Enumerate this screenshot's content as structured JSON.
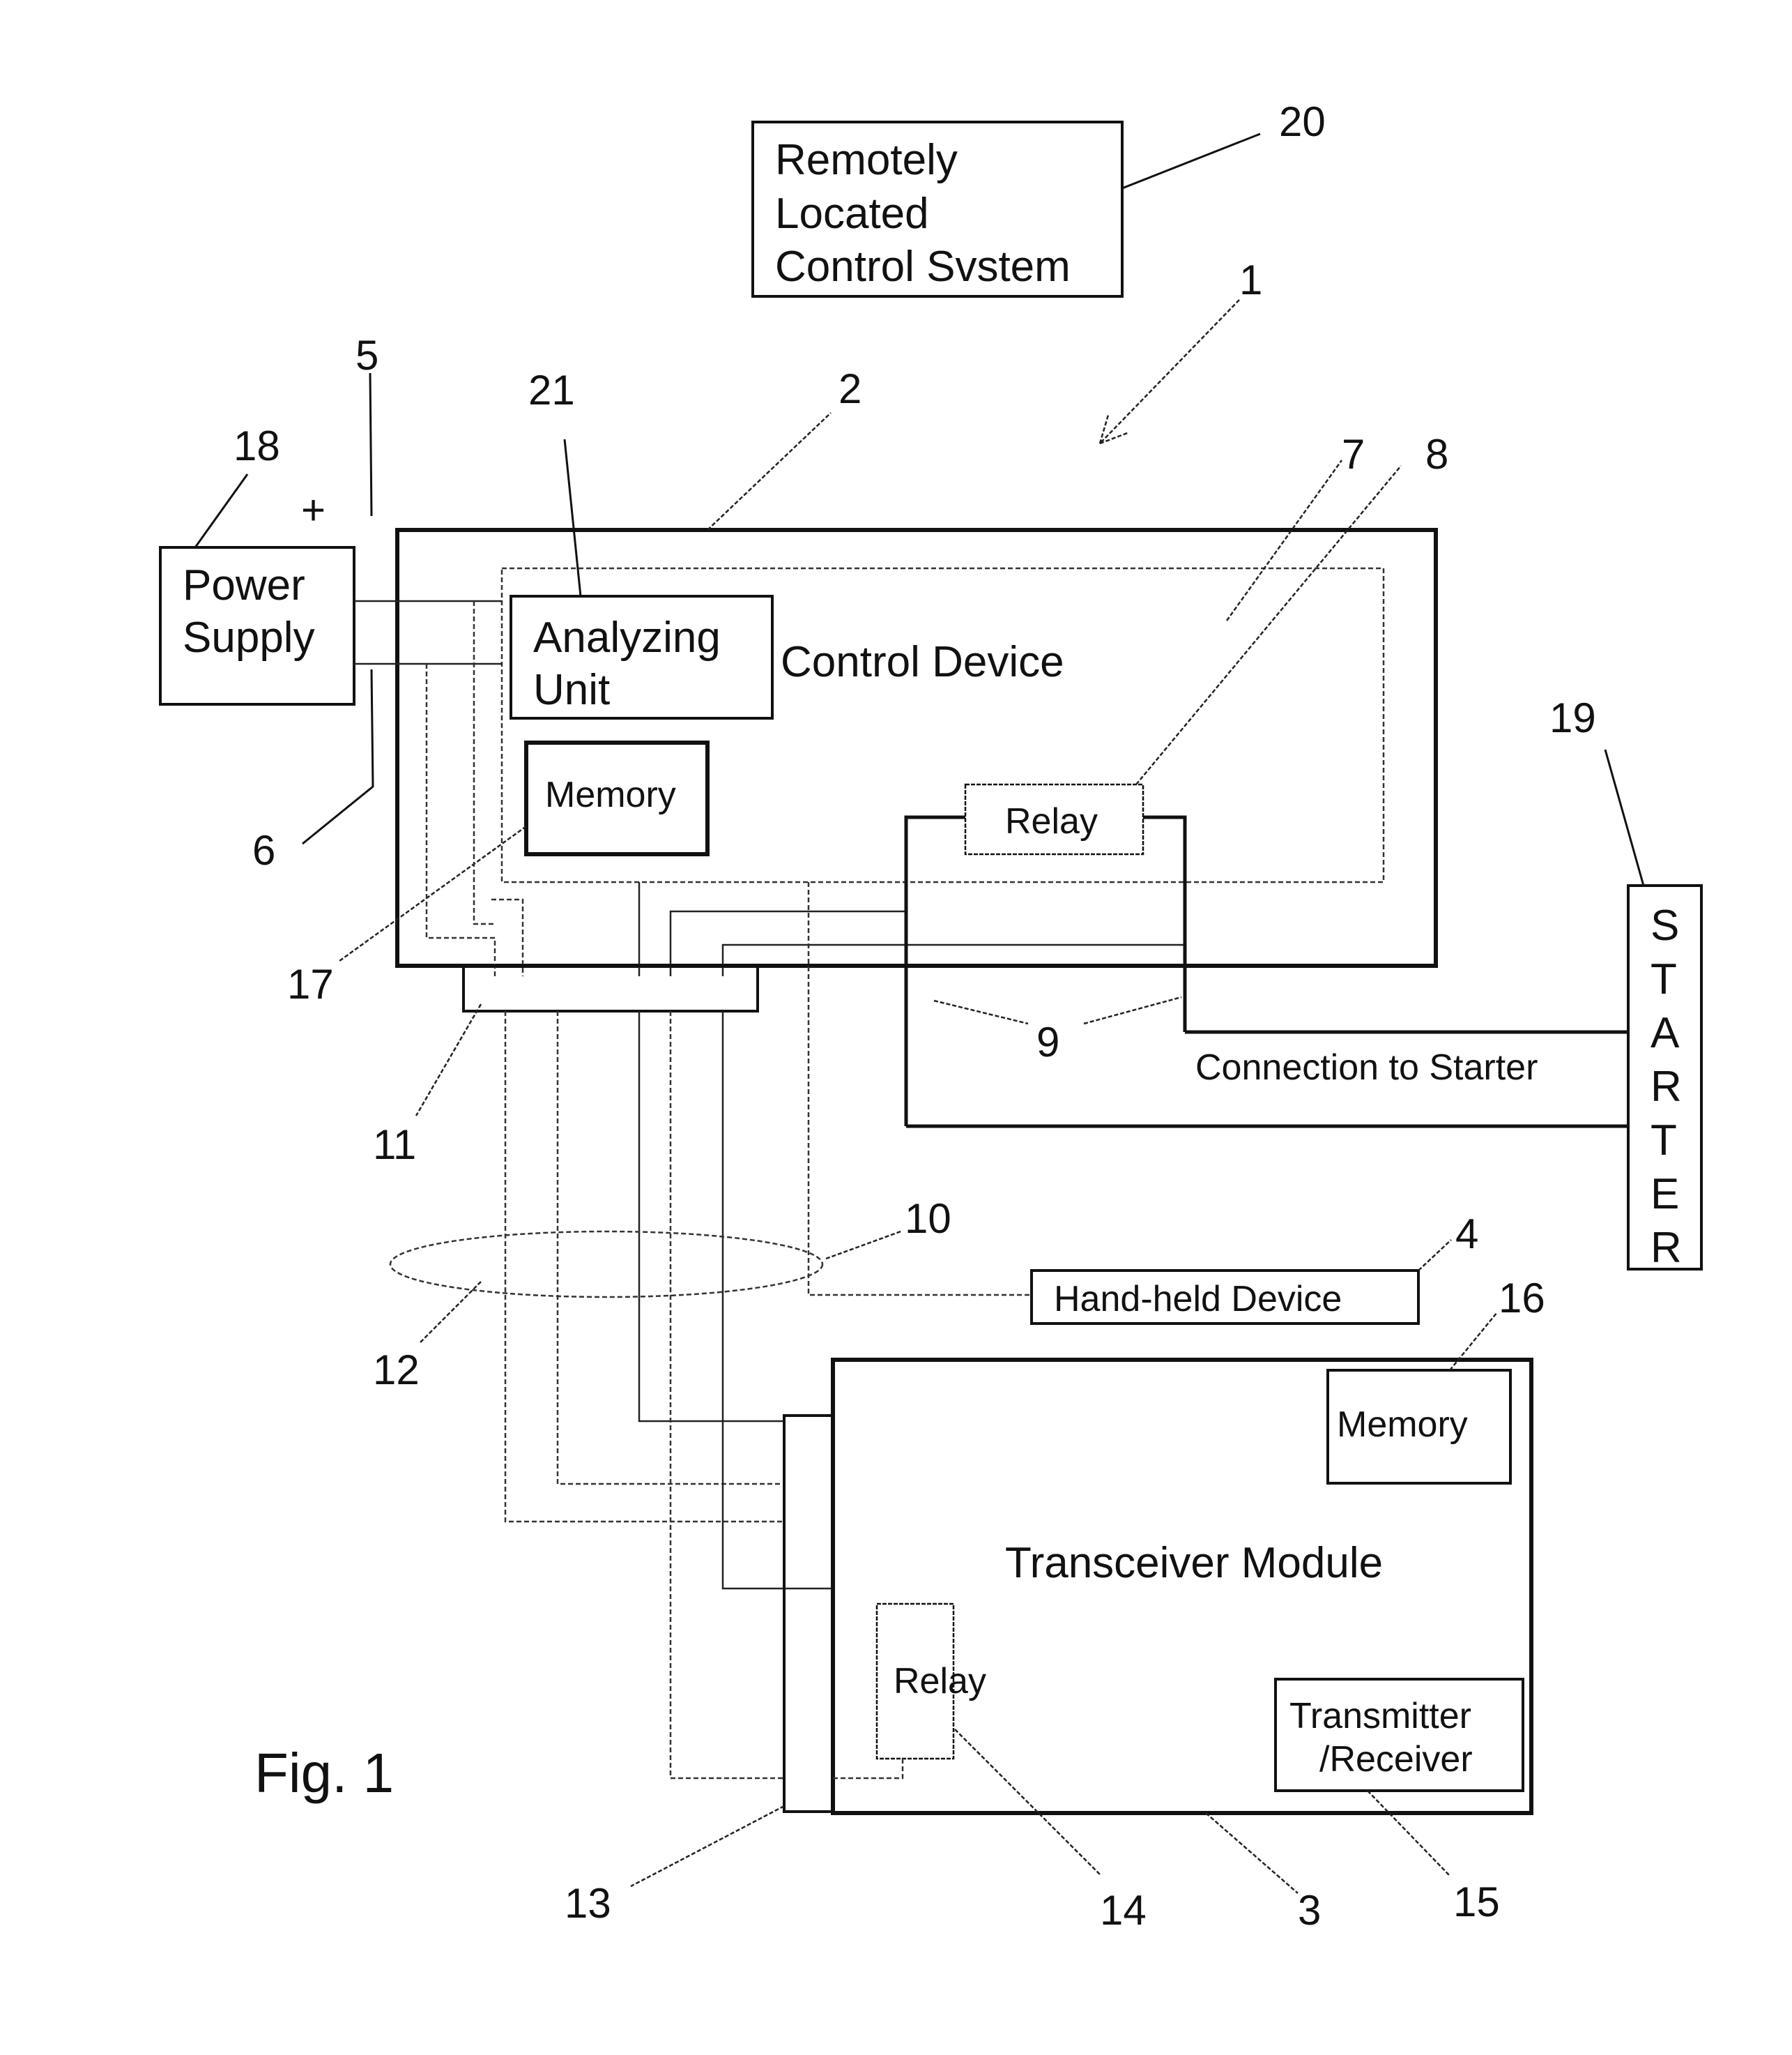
{
  "figure": {
    "caption": "Fig. 1",
    "overall_system_ref": "1"
  },
  "remote_control_system": {
    "ref": "20",
    "lines": [
      "Remotely",
      "Located",
      "Control Svstem"
    ]
  },
  "power_supply": {
    "ref": "18",
    "lines": [
      "Power",
      "Supply"
    ],
    "polarity_symbol": "+",
    "positive_line_ref": "5",
    "negative_line_ref": "6"
  },
  "control_device": {
    "ref": "2",
    "label": "Control Device",
    "inner_area_ref": "7",
    "analyzing_unit": {
      "ref": "21",
      "lines": [
        "Analyzing",
        "Unit"
      ]
    },
    "memory": {
      "ref": "17",
      "label": "Memory"
    },
    "relay": {
      "ref": "8",
      "label": "Relay"
    },
    "connector_ref": "11"
  },
  "starter": {
    "ref": "19",
    "letters": [
      "S",
      "T",
      "A",
      "R",
      "T",
      "E",
      "R"
    ],
    "connection_label": "Connection to Starter",
    "connection_ref": "9"
  },
  "cable": {
    "bundle_ref": "12",
    "handheld_line_ref": "10"
  },
  "handheld_device": {
    "ref": "4",
    "label": "Hand-held Device"
  },
  "transceiver_module": {
    "ref": "3",
    "label": "Transceiver Module",
    "connector_ref": "13",
    "memory": {
      "ref": "16",
      "label": "Memory"
    },
    "relay": {
      "ref": "14",
      "label": "Relay"
    },
    "transmitter_receiver": {
      "ref": "15",
      "lines": [
        "Transmitter",
        "/Receiver"
      ]
    }
  }
}
